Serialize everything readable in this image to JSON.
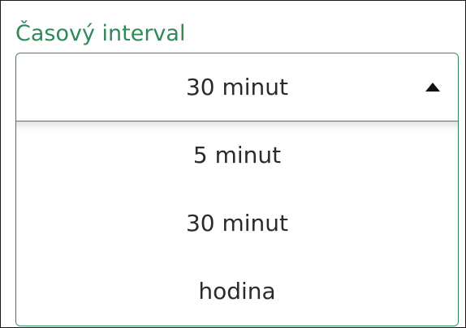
{
  "field": {
    "label": "Časový interval",
    "selected_value": "30 minut",
    "options": [
      "5 minut",
      "30 minut",
      "hodina"
    ]
  },
  "colors": {
    "accent": "#2e8b57",
    "text": "#2b2b2b",
    "caret": "#111111"
  },
  "icons": {
    "caret": "caret-up-icon"
  }
}
